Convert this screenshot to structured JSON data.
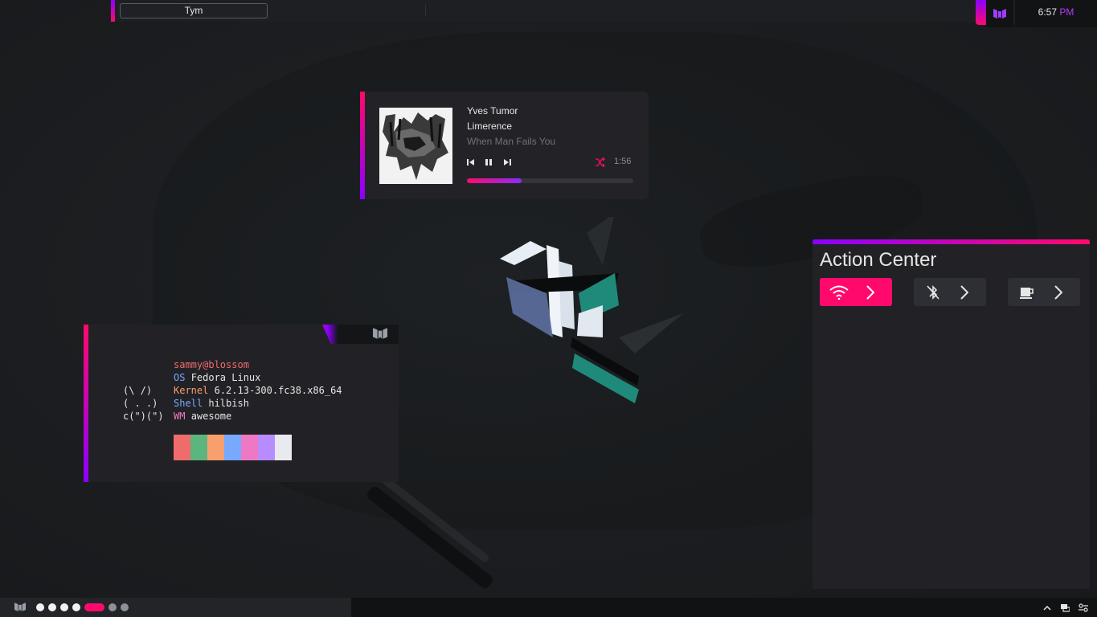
{
  "topbar": {
    "search_label": "Tym"
  },
  "clock": {
    "time": "6:57",
    "ampm": "PM"
  },
  "music": {
    "artist": "Yves Tumor",
    "album": "Limerence",
    "song": "When Man Fails You",
    "elapsed": "1:56",
    "progress_fraction": 0.33,
    "accent": "#ff0a6c"
  },
  "fetch": {
    "user_host": "sammy@blossom",
    "ascii": [
      "(\\ /)",
      "( . .)",
      "c(\")(\")"
    ],
    "os_key": "OS",
    "os_val": "Fedora Linux",
    "kernel_key": "Kernel",
    "kernel_val": "6.2.13-300.fc38.x86_64",
    "shell_key": "Shell",
    "shell_val": "hilbish",
    "wm_key": "WM",
    "wm_val": "awesome",
    "palette": [
      "#f06b6b",
      "#5cb57c",
      "#f8a06d",
      "#78a9ff",
      "#ee78c4",
      "#b68cff",
      "#e8eaf0"
    ]
  },
  "action_center": {
    "title": "Action Center",
    "tiles": [
      {
        "name": "wifi",
        "icon": "wifi-icon",
        "active": true
      },
      {
        "name": "bluetooth",
        "icon": "bluetooth-off-icon",
        "active": false
      },
      {
        "name": "caffeine",
        "icon": "coffee-cup-icon",
        "active": false
      }
    ]
  },
  "taskbar": {
    "workspaces": [
      "inactive",
      "inactive",
      "inactive",
      "inactive",
      "active",
      "empty",
      "empty"
    ],
    "tray_icons": [
      "chevron-up-icon",
      "display-icon",
      "settings-icon"
    ]
  },
  "colors": {
    "accent_pink": "#ff0a6c",
    "accent_purple": "#8a00ff",
    "panel": "#222226",
    "background": "#1b1d20"
  }
}
